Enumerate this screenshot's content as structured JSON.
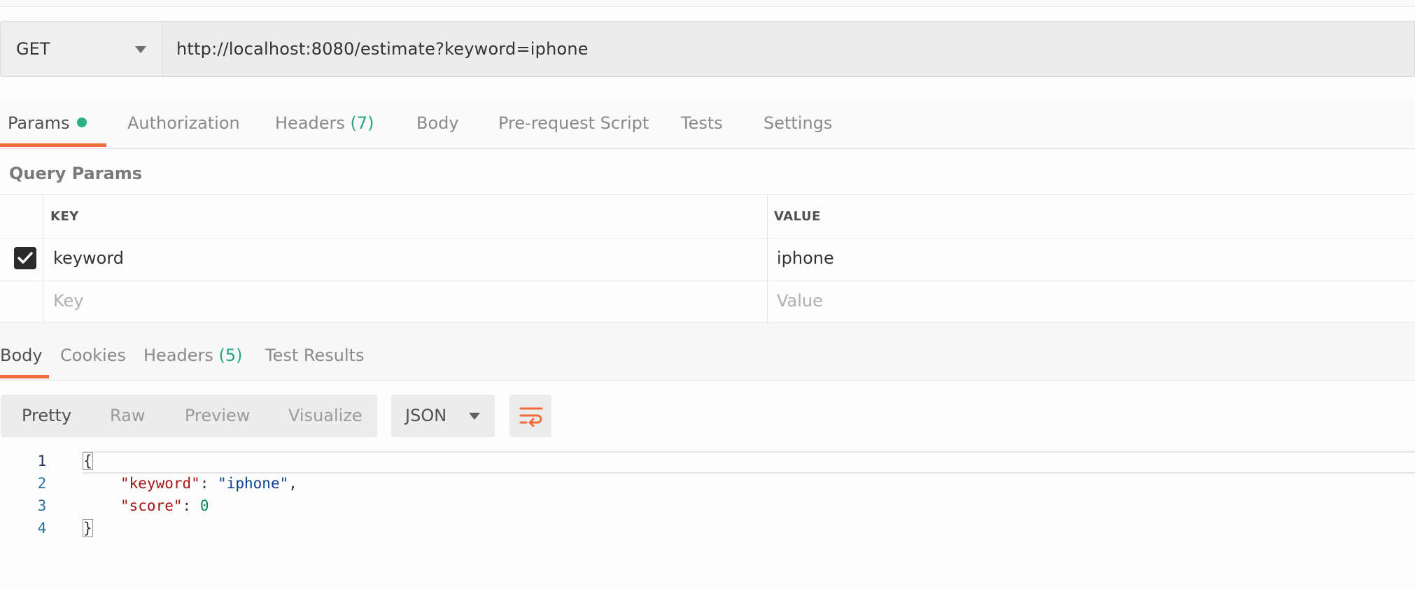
{
  "request": {
    "method": "GET",
    "url": "http://localhost:8080/estimate?keyword=iphone"
  },
  "request_tabs": {
    "params": "Params",
    "authorization": "Authorization",
    "headers": "Headers",
    "headers_count": "(7)",
    "body": "Body",
    "pre_request_script": "Pre-request Script",
    "tests": "Tests",
    "settings": "Settings"
  },
  "query_params": {
    "title": "Query Params",
    "key_header": "KEY",
    "value_header": "VALUE",
    "rows": [
      {
        "key": "keyword",
        "value": "iphone",
        "checked": true
      }
    ],
    "key_placeholder": "Key",
    "value_placeholder": "Value"
  },
  "response_tabs": {
    "body": "Body",
    "cookies": "Cookies",
    "headers": "Headers",
    "headers_count": "(5)",
    "test_results": "Test Results"
  },
  "view_modes": {
    "pretty": "Pretty",
    "raw": "Raw",
    "preview": "Preview",
    "visualize": "Visualize"
  },
  "format": "JSON",
  "wrap_icon": "wrap-lines-icon",
  "code": {
    "line_numbers": [
      "1",
      "2",
      "3",
      "4"
    ],
    "open_brace": "{",
    "close_brace": "}",
    "keyword_key": "\"keyword\"",
    "keyword_value": "\"iphone\"",
    "score_key": "\"score\"",
    "score_value": "0",
    "colon": ": ",
    "comma": ","
  },
  "colors": {
    "accent": "#f26b3a",
    "status_green": "#26b47f",
    "count_green": "#26a784"
  }
}
